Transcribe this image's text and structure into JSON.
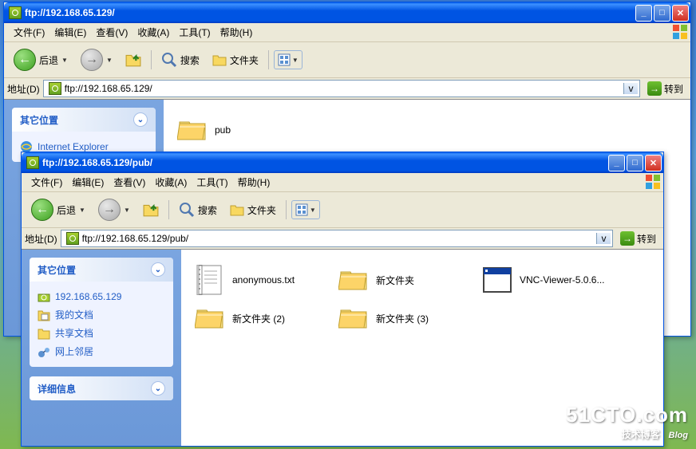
{
  "window1": {
    "title": "ftp://192.168.65.129/",
    "menu": {
      "file": "文件(F)",
      "edit": "编辑(E)",
      "view": "查看(V)",
      "fav": "收藏(A)",
      "tools": "工具(T)",
      "help": "帮助(H)"
    },
    "toolbar": {
      "back": "后退",
      "search": "搜索",
      "folders": "文件夹"
    },
    "address": {
      "label": "地址(D)",
      "value": "ftp://192.168.65.129/",
      "go": "转到"
    },
    "sidepanel": {
      "other_places": "其它位置",
      "ie": "Internet Explorer"
    },
    "files": {
      "pub": "pub"
    }
  },
  "window2": {
    "title": "ftp://192.168.65.129/pub/",
    "menu": {
      "file": "文件(F)",
      "edit": "编辑(E)",
      "view": "查看(V)",
      "fav": "收藏(A)",
      "tools": "工具(T)",
      "help": "帮助(H)"
    },
    "toolbar": {
      "back": "后退",
      "search": "搜索",
      "folders": "文件夹"
    },
    "address": {
      "label": "地址(D)",
      "value": "ftp://192.168.65.129/pub/",
      "go": "转到"
    },
    "sidepanel": {
      "other_places": "其它位置",
      "links": {
        "parent": "192.168.65.129",
        "mydocs": "我的文档",
        "shared": "共享文档",
        "network": "网上邻居"
      },
      "details": "详细信息"
    },
    "files": {
      "f1": "anonymous.txt",
      "f2": "新文件夹",
      "f3": "VNC-Viewer-5.0.6...",
      "f4": "新文件夹 (2)",
      "f5": "新文件夹 (3)"
    }
  },
  "watermark": {
    "big": "51CTO.com",
    "small": "技术博客",
    "blog": "Blog"
  }
}
